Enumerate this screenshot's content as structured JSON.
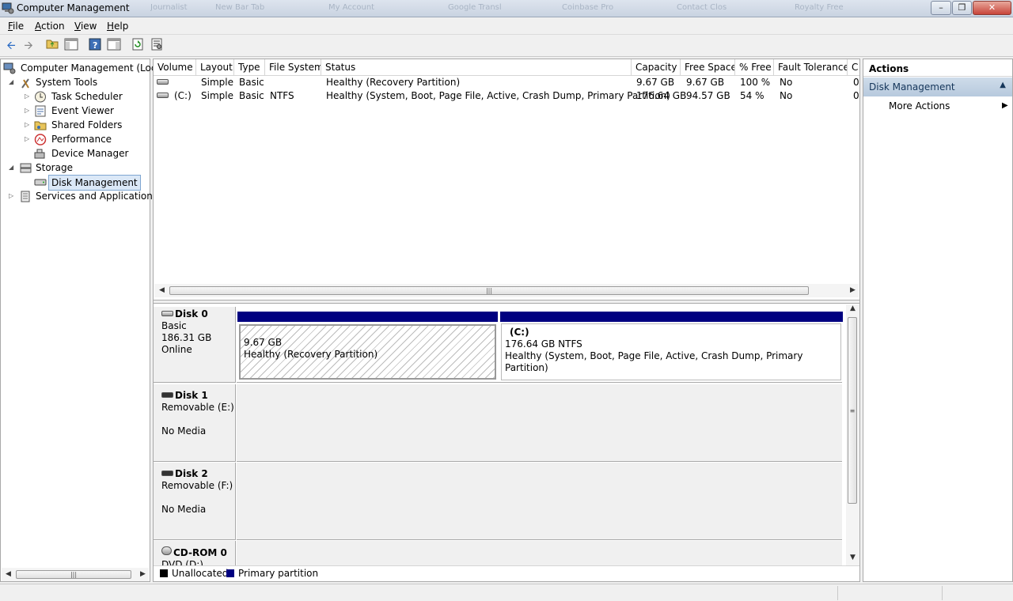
{
  "window": {
    "title": "Computer Management",
    "background_tabs": [
      "Journalist",
      "New Bar Tab",
      "My Account",
      "Google Transl",
      "Coinbase Pro",
      "Contact Clos",
      "Royalty Free"
    ]
  },
  "menu": [
    "File",
    "Action",
    "View",
    "Help"
  ],
  "toolbar": [
    "back-icon",
    "forward-icon",
    "up-folder-icon",
    "show-hide-tree-icon",
    "help-icon",
    "show-hide-action-pane-icon",
    "refresh-icon",
    "properties-icon"
  ],
  "tree": {
    "root": "Computer Management (Local",
    "system_tools": "System Tools",
    "task_scheduler": "Task Scheduler",
    "event_viewer": "Event Viewer",
    "shared_folders": "Shared Folders",
    "performance": "Performance",
    "device_manager": "Device Manager",
    "storage": "Storage",
    "disk_management": "Disk Management",
    "services": "Services and Applications"
  },
  "volume_list": {
    "columns": [
      "Volume",
      "Layout",
      "Type",
      "File System",
      "Status",
      "Capacity",
      "Free Space",
      "% Free",
      "Fault Tolerance",
      "C"
    ],
    "rows": [
      {
        "volume": "",
        "layout": "Simple",
        "type": "Basic",
        "fs": "",
        "status": "Healthy (Recovery Partition)",
        "capacity": "9.67 GB",
        "free": "9.67 GB",
        "pct": "100 %",
        "fault": "No",
        "overhead": "0"
      },
      {
        "volume": "(C:)",
        "layout": "Simple",
        "type": "Basic",
        "fs": "NTFS",
        "status": "Healthy (System, Boot, Page File, Active, Crash Dump, Primary Partition)",
        "capacity": "176.64 GB",
        "free": "94.57 GB",
        "pct": "54 %",
        "fault": "No",
        "overhead": "0"
      }
    ]
  },
  "disks": {
    "disk0": {
      "name": "Disk 0",
      "type": "Basic",
      "size": "186.31 GB",
      "state": "Online",
      "p1": {
        "size": "9.67 GB",
        "status": "Healthy (Recovery Partition)"
      },
      "p2": {
        "label": "(C:)",
        "size": "176.64 GB NTFS",
        "status": "Healthy (System, Boot, Page File, Active, Crash Dump, Primary Partition)"
      }
    },
    "disk1": {
      "name": "Disk 1",
      "type": "Removable (E:)",
      "state": "No Media"
    },
    "disk2": {
      "name": "Disk 2",
      "type": "Removable (F:)",
      "state": "No Media"
    },
    "cdrom0": {
      "name": "CD-ROM 0",
      "type": "DVD (D:)"
    }
  },
  "legend": {
    "unallocated": "Unallocated",
    "primary": "Primary partition",
    "colors": {
      "unallocated": "#000000",
      "primary": "#000080"
    }
  },
  "actions": {
    "header": "Actions",
    "section": "Disk Management",
    "more": "More Actions"
  }
}
